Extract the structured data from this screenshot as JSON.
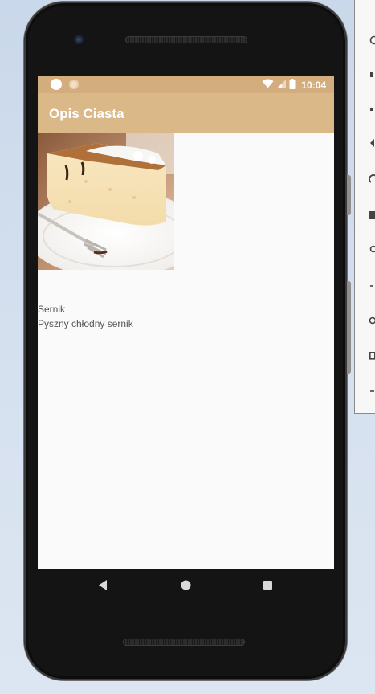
{
  "status_bar": {
    "time": "10:04",
    "icons": [
      "notification-dot-icon",
      "notification-dot-icon",
      "wifi-icon",
      "signal-icon",
      "battery-icon"
    ]
  },
  "app_bar": {
    "title": "Opis Ciasta"
  },
  "content": {
    "image_icon": "cake-slice-image",
    "cake_name": "Sernik",
    "cake_description": "Pyszny chłodny sernik"
  },
  "nav_bar": {
    "icons": [
      "back-icon",
      "home-icon",
      "recents-icon"
    ]
  },
  "colors": {
    "status_bar": "#d4ad7e",
    "app_bar": "#dbb888",
    "screen_bg": "#fafafa",
    "text": "#555555"
  }
}
